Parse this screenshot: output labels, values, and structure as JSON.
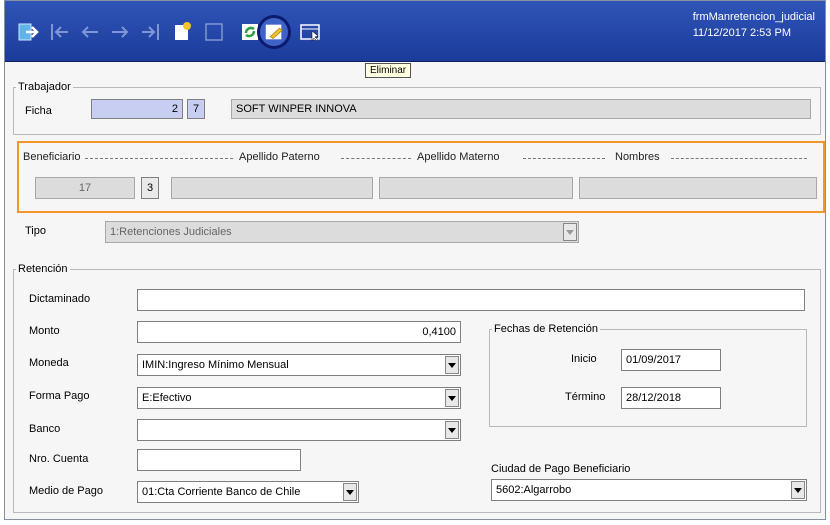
{
  "toolbar": {
    "icons": [
      "exit-icon",
      "first-record-icon",
      "previous-record-icon",
      "next-record-icon",
      "last-record-icon",
      "new-record-icon",
      "blank-icon",
      "refresh-icon",
      "delete-icon",
      "view-icon"
    ],
    "tooltip": "Eliminar"
  },
  "window": {
    "form_name": "frmManretencion_judicial",
    "datetime": "11/12/2017 2:53 PM"
  },
  "trabajador": {
    "legend": "Trabajador",
    "ficha_label": "Ficha",
    "ficha_value": "2",
    "ficha_dv": "7",
    "nombre": "SOFT WINPER INNOVA"
  },
  "beneficiario": {
    "label": "Beneficiario",
    "col_paterno": "Apellido Paterno",
    "col_materno": "Apellido Materno",
    "col_nombres": "Nombres",
    "rut": "17",
    "dv": "3",
    "paterno": "",
    "materno": "",
    "nombres": ""
  },
  "tipo": {
    "label": "Tipo",
    "value": "1:Retenciones Judiciales"
  },
  "retencion": {
    "legend": "Retención",
    "dictaminado_label": "Dictaminado",
    "dictaminado_value": "",
    "monto_label": "Monto",
    "monto_value": "0,4100",
    "moneda_label": "Moneda",
    "moneda_value": "IMIN:Ingreso Mínimo Mensual",
    "forma_pago_label": "Forma Pago",
    "forma_pago_value": "E:Efectivo",
    "banco_label": "Banco",
    "banco_value": "",
    "nro_cuenta_label": "Nro. Cuenta",
    "nro_cuenta_value": "",
    "medio_pago_label": "Medio de Pago",
    "medio_pago_value": "01:Cta Corriente Banco de Chile"
  },
  "fechas": {
    "legend": "Fechas de Retención",
    "inicio_label": "Inicio",
    "inicio_value": "01/09/2017",
    "termino_label": "Término",
    "termino_value": "28/12/2018"
  },
  "ciudad": {
    "label": "Ciudad de Pago Beneficiario",
    "value": "5602:Algarrobo"
  },
  "colors": {
    "toolbar": "#1f43a6",
    "highlight": "#f0962d",
    "blue_field": "#c8cdf2"
  }
}
